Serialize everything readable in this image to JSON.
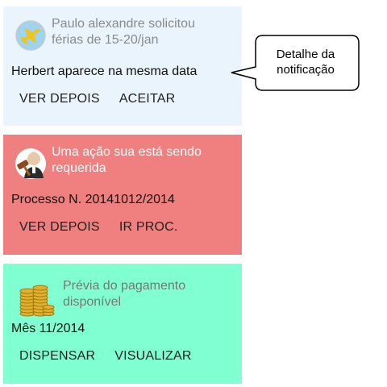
{
  "notifications": [
    {
      "icon": "airplane-icon",
      "title": "Paulo alexandre solicitou férias de 15-20/jan",
      "detail": "Herbert aparece na mesma data",
      "actions": [
        "VER DEPOIS",
        "ACEITAR"
      ],
      "background": "#eaf4fd"
    },
    {
      "icon": "judge-gavel-icon",
      "title": "Uma ação sua está sendo requerida",
      "detail": "Processo N. 20141012/2014",
      "actions": [
        "VER DEPOIS",
        "IR PROC."
      ],
      "background": "#f08080"
    },
    {
      "icon": "coins-icon",
      "title": "Prévia do pagamento disponível",
      "detail": "Mês 11/2014",
      "actions": [
        "DISPENSAR",
        "VISUALIZAR"
      ],
      "background": "#80ffd2"
    }
  ],
  "callout": {
    "text": "Detalhe da notificação"
  }
}
